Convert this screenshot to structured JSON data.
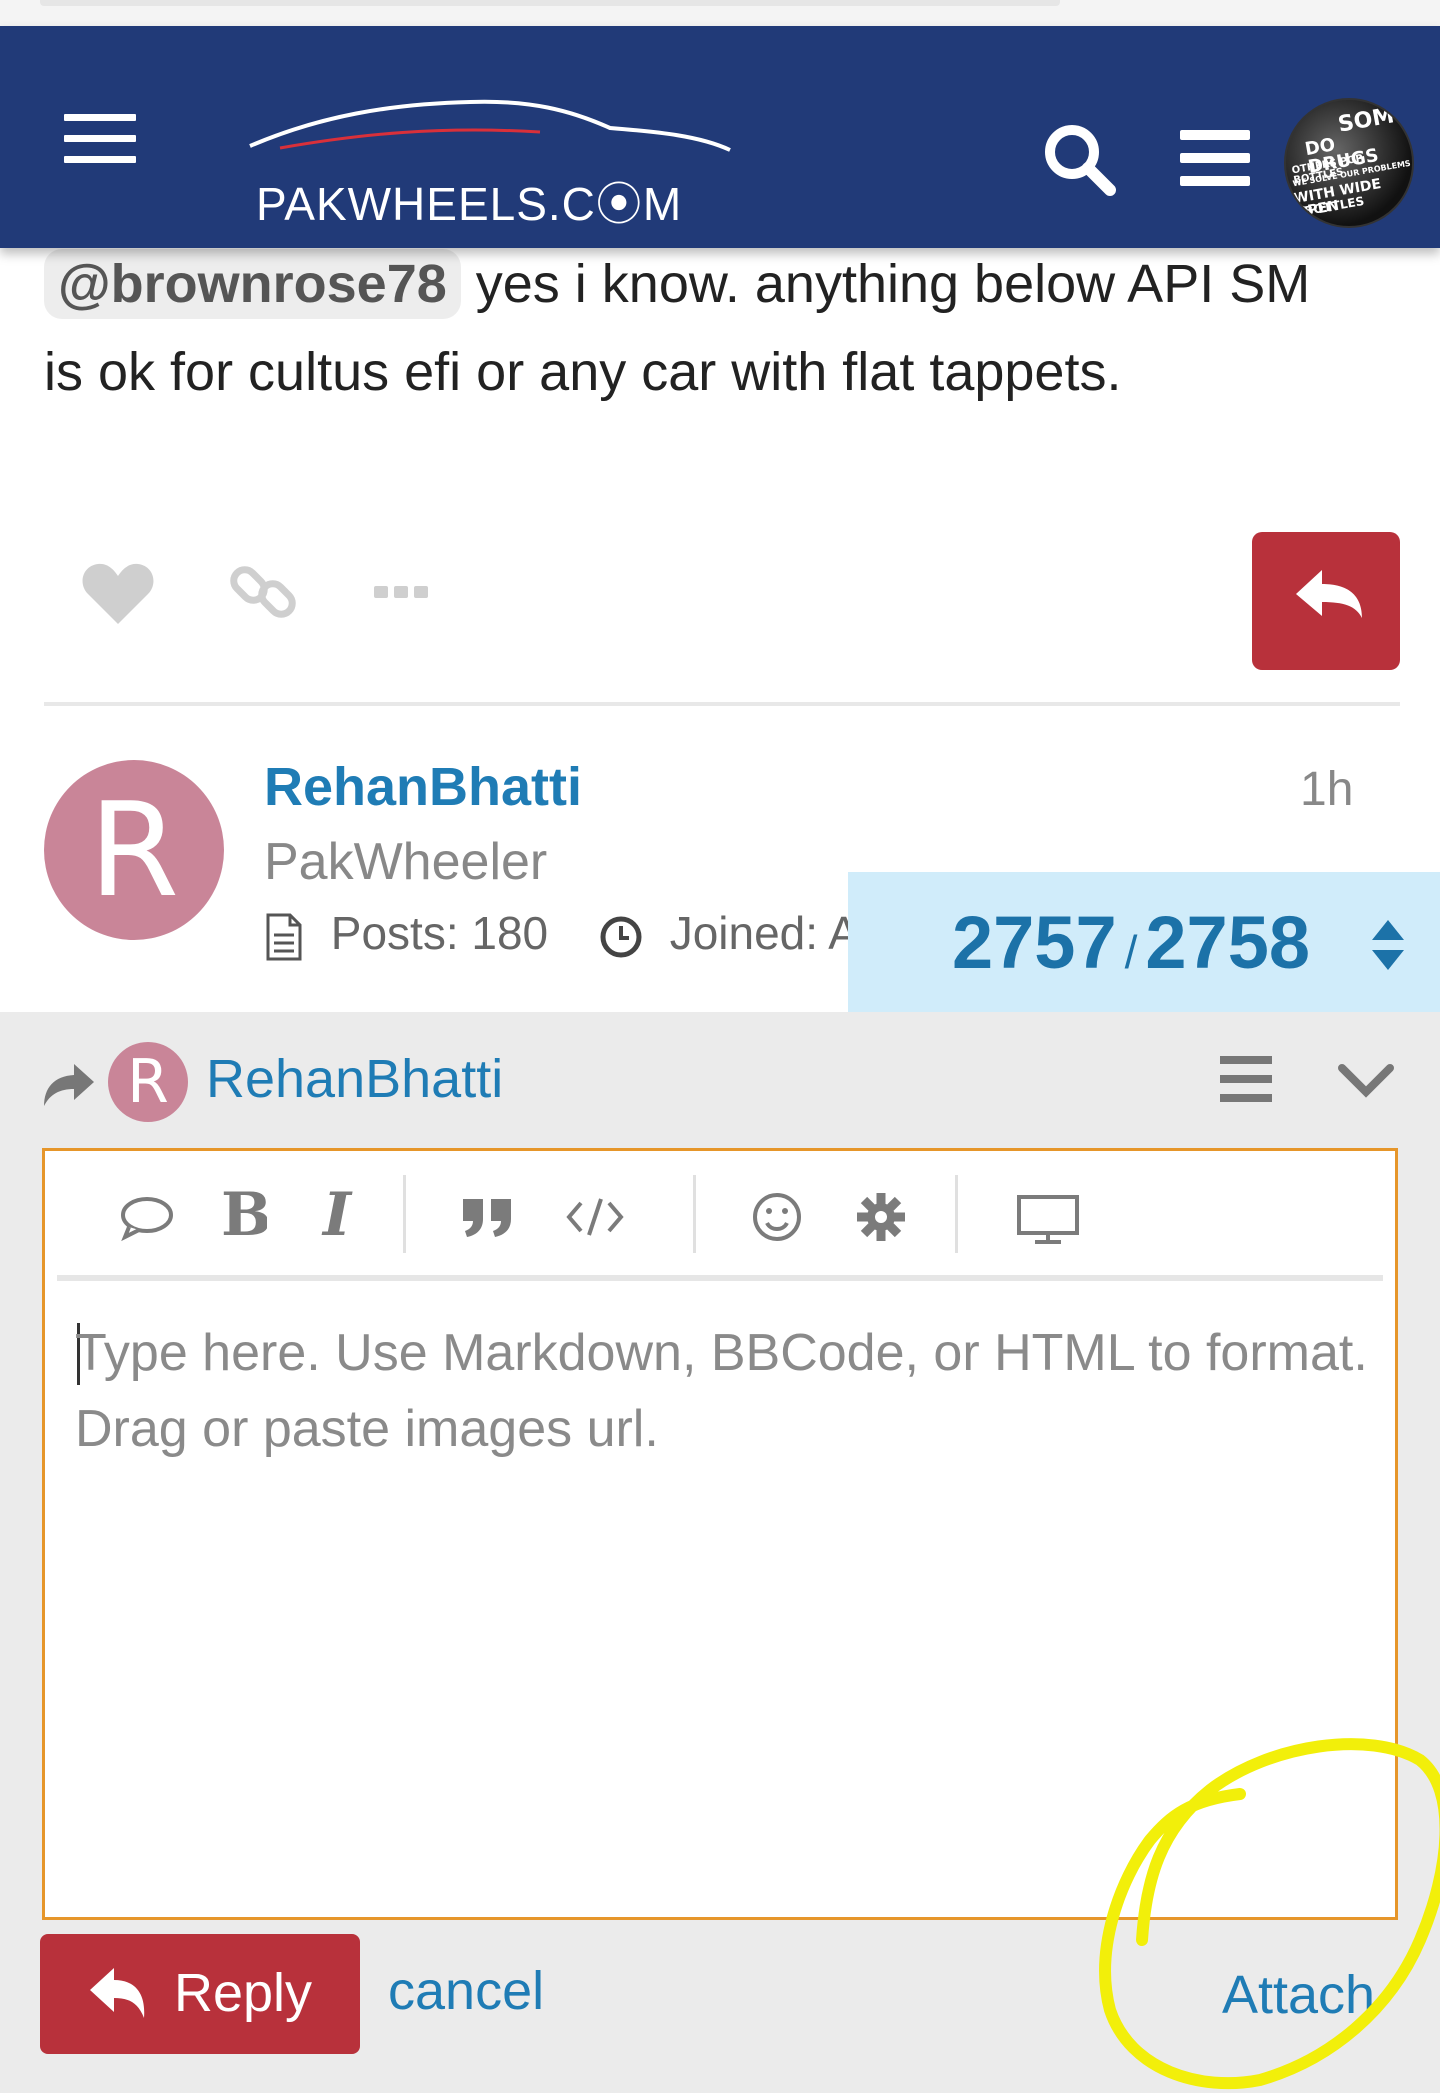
{
  "header": {
    "logo_text": "PAKWHEELS.C⦿M",
    "avatar_text": [
      "SOM",
      "DO DRUGS",
      "OTHERS POP BOTTLES",
      "WE SOLVE OUR PROBLEMS",
      "WITH WIDE OPEN",
      "BOTTLES"
    ]
  },
  "post": {
    "mention": "@brownrose78",
    "text_line1": " yes i know. anything below API SM",
    "text_line2": "is ok for cultus efi or any car with flat tappets."
  },
  "next_post": {
    "avatar_letter": "R",
    "username": "RehanBhatti",
    "time": "1h",
    "title": "PakWheeler",
    "posts_label": "Posts: 180",
    "joined_label": "Joined: A"
  },
  "progress": {
    "current": "2757",
    "separator": "/",
    "total": "2758"
  },
  "composer": {
    "avatar_letter": "R",
    "reply_to_user": "RehanBhatti",
    "placeholder": "Type here. Use Markdown, BBCode, or HTML to format. Drag or paste images url.",
    "reply_label": "Reply",
    "cancel_label": "cancel",
    "attach_label": "Attach"
  },
  "colors": {
    "header_bg": "#213a78",
    "accent_red": "#b8313b",
    "link_blue": "#1f7cb5",
    "progress_bg": "#d0ecfa",
    "editor_border": "#e6962a",
    "highlight": "#f2ef0a"
  }
}
